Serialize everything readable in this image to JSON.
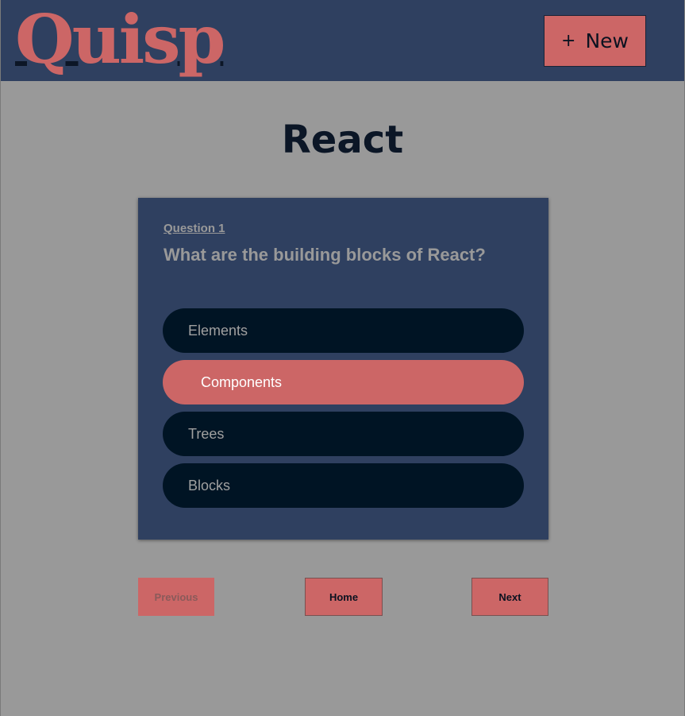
{
  "header": {
    "logo_text": "Quisp",
    "new_button_icon": "plus-icon",
    "new_button_plus": "+",
    "new_button_label": "New"
  },
  "page": {
    "title": "React"
  },
  "question": {
    "number_label": "Question 1",
    "text": "What are the building blocks of React?",
    "options": [
      {
        "label": "Elements",
        "selected": false
      },
      {
        "label": "Components",
        "selected": true
      },
      {
        "label": "Trees",
        "selected": false
      },
      {
        "label": "Blocks",
        "selected": false
      }
    ]
  },
  "navigation": {
    "previous_label": "Previous",
    "previous_disabled": true,
    "home_label": "Home",
    "next_label": "Next"
  },
  "colors": {
    "header_bg": "#2f4060",
    "accent": "#cc6666",
    "page_bg": "#999999",
    "option_bg": "#001424"
  }
}
